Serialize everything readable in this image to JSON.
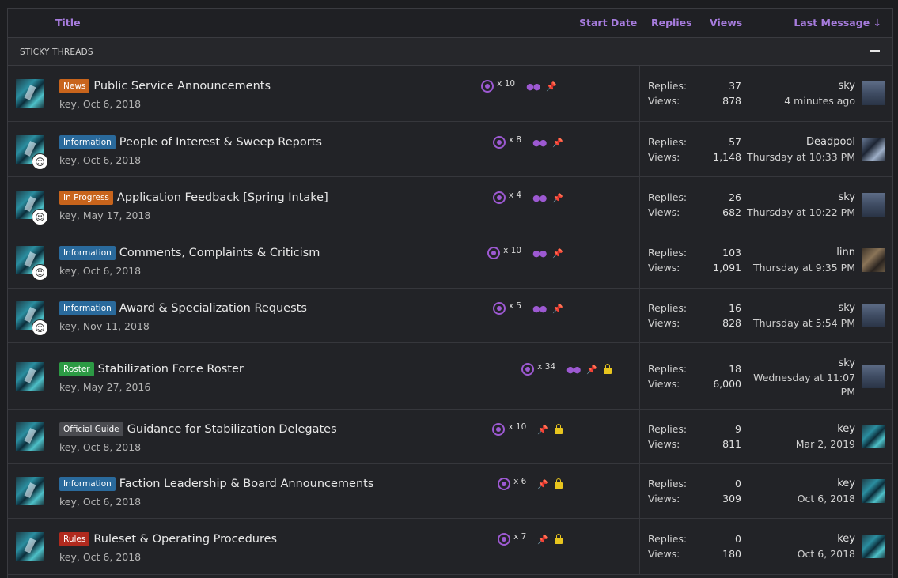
{
  "header": {
    "title": "Title",
    "start_date": "Start Date",
    "replies": "Replies",
    "views": "Views",
    "last_message": "Last Message ↓"
  },
  "section": {
    "label": "STICKY THREADS"
  },
  "labels": {
    "replies": "Replies:",
    "views": "Views:"
  },
  "threads": [
    {
      "tag": "News",
      "tag_color": "#c8641c",
      "title": "Public Service Announcements",
      "author_date": "key, Oct 6, 2018",
      "watchers": "x 10",
      "replies": "37",
      "views": "878",
      "last_user": "sky",
      "last_time": "4 minutes ago",
      "binoculars": true,
      "pinned": true,
      "locked": false,
      "author_badge": false
    },
    {
      "tag": "Information",
      "tag_color": "#2a6a9c",
      "title": "People of Interest & Sweep Reports",
      "author_date": "key, Oct 6, 2018",
      "watchers": "x 8",
      "replies": "57",
      "views": "1,148",
      "last_user": "Deadpool",
      "last_time": "Thursday at 10:33 PM",
      "binoculars": true,
      "pinned": true,
      "locked": false,
      "author_badge": true
    },
    {
      "tag": "In Progress",
      "tag_color": "#c8641c",
      "title": "Application Feedback [Spring Intake]",
      "author_date": "key, May 17, 2018",
      "watchers": "x 4",
      "replies": "26",
      "views": "682",
      "last_user": "sky",
      "last_time": "Thursday at 10:22 PM",
      "binoculars": true,
      "pinned": true,
      "locked": false,
      "author_badge": true
    },
    {
      "tag": "Information",
      "tag_color": "#2a6a9c",
      "title": "Comments, Complaints & Criticism",
      "author_date": "key, Oct 6, 2018",
      "watchers": "x 10",
      "replies": "103",
      "views": "1,091",
      "last_user": "linn",
      "last_time": "Thursday at 9:35 PM",
      "binoculars": true,
      "pinned": true,
      "locked": false,
      "author_badge": true
    },
    {
      "tag": "Information",
      "tag_color": "#2a6a9c",
      "title": "Award & Specialization Requests",
      "author_date": "key, Nov 11, 2018",
      "watchers": "x 5",
      "replies": "16",
      "views": "828",
      "last_user": "sky",
      "last_time": "Thursday at 5:54 PM",
      "binoculars": true,
      "pinned": true,
      "locked": false,
      "author_badge": true
    },
    {
      "tag": "Roster",
      "tag_color": "#2c9a44",
      "title": "Stabilization Force Roster",
      "author_date": "key, May 27, 2016",
      "watchers": "x 34",
      "replies": "18",
      "views": "6,000",
      "last_user": "sky",
      "last_time": "Wednesday at 11:07 PM",
      "binoculars": true,
      "pinned": true,
      "locked": true,
      "author_badge": false
    },
    {
      "tag": "Official Guide",
      "tag_color": "#4a4b50",
      "title": "Guidance for Stabilization Delegates",
      "author_date": "key, Oct 8, 2018",
      "watchers": "x 10",
      "replies": "9",
      "views": "811",
      "last_user": "key",
      "last_time": "Mar 2, 2019",
      "binoculars": false,
      "pinned": true,
      "locked": true,
      "author_badge": false
    },
    {
      "tag": "Information",
      "tag_color": "#2a6a9c",
      "title": "Faction Leadership & Board Announcements",
      "author_date": "key, Oct 6, 2018",
      "watchers": "x 6",
      "replies": "0",
      "views": "309",
      "last_user": "key",
      "last_time": "Oct 6, 2018",
      "binoculars": false,
      "pinned": true,
      "locked": true,
      "author_badge": false
    },
    {
      "tag": "Rules",
      "tag_color": "#b02a1e",
      "title": "Ruleset & Operating Procedures",
      "author_date": "key, Oct 6, 2018",
      "watchers": "x 7",
      "replies": "0",
      "views": "180",
      "last_user": "key",
      "last_time": "Oct 6, 2018",
      "binoculars": false,
      "pinned": true,
      "locked": true,
      "author_badge": false
    }
  ]
}
